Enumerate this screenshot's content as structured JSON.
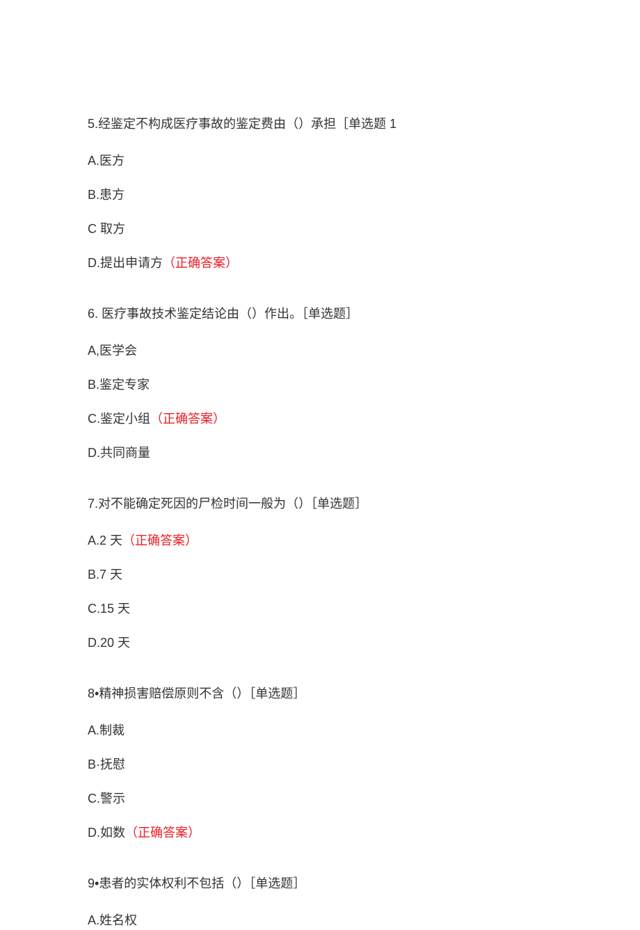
{
  "questions": [
    {
      "num": "5.",
      "text": "经鉴定不构成医疗事故的鉴定费由（）承担［单选题 1",
      "options": [
        {
          "label": "A.",
          "text": "医方",
          "correct": false
        },
        {
          "label": "B.",
          "text": "患方",
          "correct": false
        },
        {
          "label": "C",
          "text": " 取方",
          "correct": false
        },
        {
          "label": "D.",
          "text": "提出申请方",
          "correct": true
        }
      ]
    },
    {
      "num": "6. ",
      "text": "医疗事故技术鉴定结论由（）作出。［单选题］",
      "options": [
        {
          "label": "A,",
          "text": "医学会",
          "correct": false
        },
        {
          "label": "B.",
          "text": "鉴定专家",
          "correct": false
        },
        {
          "label": "C.",
          "text": "鉴定小组",
          "correct": true
        },
        {
          "label": "D.",
          "text": "共同商量",
          "correct": false
        }
      ]
    },
    {
      "num": "7.",
      "text": "对不能确定死因的尸检时间一般为（）［单选题］",
      "options": [
        {
          "label": "A.",
          "text": "2 天",
          "correct": true
        },
        {
          "label": "B.",
          "text": "7 天",
          "correct": false
        },
        {
          "label": "C.",
          "text": "15 天",
          "correct": false
        },
        {
          "label": "D.",
          "text": "20 天",
          "correct": false
        }
      ]
    },
    {
      "num": "8•",
      "text": "精神损害赔偿原则不含（）［单选题］",
      "options": [
        {
          "label": "A.",
          "text": "制裁",
          "correct": false
        },
        {
          "label": "B·",
          "text": "抚慰",
          "correct": false
        },
        {
          "label": "C.",
          "text": "警示",
          "correct": false
        },
        {
          "label": "D.",
          "text": "如数",
          "correct": true
        }
      ]
    },
    {
      "num": "9•",
      "text": "患者的实体权利不包括（）［单选题］",
      "options": [
        {
          "label": "A.",
          "text": "姓名权",
          "correct": false
        }
      ]
    }
  ],
  "correct_label": "（正确答案）"
}
